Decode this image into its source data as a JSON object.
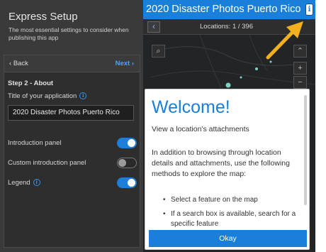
{
  "setup": {
    "title": "Express Setup",
    "subtitle": "The most essential settings to consider when publishing this app",
    "back_label": "Back",
    "next_label": "Next",
    "step_label": "Step 2 - About",
    "app_title_label": "Title of your application",
    "app_title_value": "2020 Disaster Photos Puerto Rico",
    "toggles": [
      {
        "label": "Introduction panel",
        "state": "on"
      },
      {
        "label": "Custom introduction panel",
        "state": "off"
      },
      {
        "label": "Legend",
        "state": "on"
      }
    ]
  },
  "app": {
    "header_title": "2020 Disaster Photos Puerto Rico",
    "locations_text": "Locations: 1 / 396"
  },
  "welcome": {
    "heading": "Welcome!",
    "intro": "View a location's attachments",
    "body": "In addition to browsing through location details and attachments, use the following methods to explore the map:",
    "bullets": [
      "Select a feature on the map",
      "If a search box is available, search for a specific feature"
    ],
    "okay_label": "Okay"
  },
  "colors": {
    "accent": "#1a7fd9",
    "panel": "#3a3a3a",
    "arrow": "#f2b01e"
  },
  "icons": {
    "back": "chevron-left-icon",
    "next": "chevron-right-icon",
    "info": "info-icon",
    "search": "search-icon",
    "zoom_in": "plus-icon",
    "zoom_out": "minus-icon",
    "collapse": "chevrons-up-icon"
  }
}
